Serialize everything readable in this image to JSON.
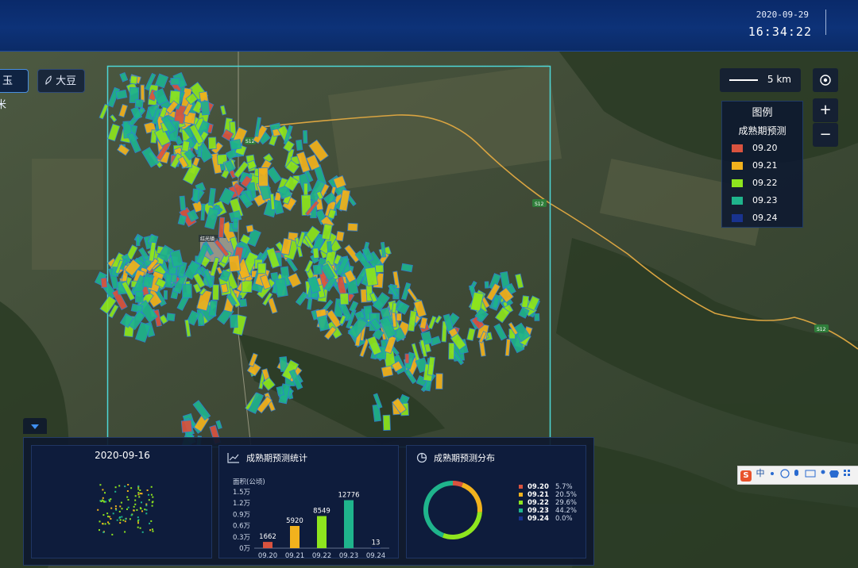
{
  "header": {
    "date": "2020-09-29",
    "time": "16:34:22"
  },
  "crop_tabs": [
    {
      "label": "玉米",
      "active": true,
      "icon": ""
    },
    {
      "label": "大豆",
      "active": false,
      "icon": "leaf-icon"
    }
  ],
  "map": {
    "scale_label": "5 km",
    "road_labels": [
      "S12",
      "S12",
      "S12"
    ],
    "town_label": "红光镇"
  },
  "legend": {
    "title": "图例",
    "subtitle": "成熟期预测",
    "items": [
      {
        "label": "09.20",
        "color": "#d9533f"
      },
      {
        "label": "09.21",
        "color": "#f2b21d"
      },
      {
        "label": "09.22",
        "color": "#8ee51e"
      },
      {
        "label": "09.23",
        "color": "#1fb48c"
      },
      {
        "label": "09.24",
        "color": "#19338f"
      }
    ]
  },
  "overview_panel": {
    "date": "2020-09-16"
  },
  "stats_panel": {
    "title": "成熟期预测统计",
    "unit_label": "面积(公顷)",
    "y_ticks": [
      "1.5万",
      "1.2万",
      "0.9万",
      "0.6万",
      "0.3万",
      "0万"
    ]
  },
  "distribution_panel": {
    "title": "成熟期预测分布"
  },
  "chart_data": [
    {
      "type": "bar",
      "title": "成熟期预测统计",
      "ylabel": "面积(公顷)",
      "categories": [
        "09.20",
        "09.21",
        "09.22",
        "09.23",
        "09.24"
      ],
      "values": [
        1662,
        5920,
        8549,
        12776,
        13
      ],
      "value_labels": [
        "1662",
        "5920",
        "8549",
        "12776",
        "13"
      ],
      "colors": [
        "#d9533f",
        "#f2b21d",
        "#8ee51e",
        "#1fb48c",
        "#19338f"
      ],
      "ylim": [
        0,
        15000
      ],
      "y_ticks": [
        "1.5万",
        "1.2万",
        "0.9万",
        "0.6万",
        "0.3万",
        "0万"
      ]
    },
    {
      "type": "pie",
      "title": "成熟期预测分布",
      "donut": true,
      "labels": [
        "09.20",
        "09.21",
        "09.22",
        "09.23",
        "09.24"
      ],
      "values": [
        5.7,
        20.5,
        29.6,
        44.2,
        0.0
      ],
      "value_labels": [
        "5.7%",
        "20.5%",
        "29.6%",
        "44.2%",
        "0.0%"
      ],
      "colors": [
        "#d9533f",
        "#f2b21d",
        "#8ee51e",
        "#1fb48c",
        "#19338f"
      ]
    }
  ],
  "ime_bar": {
    "brand": "S",
    "text": "中"
  }
}
